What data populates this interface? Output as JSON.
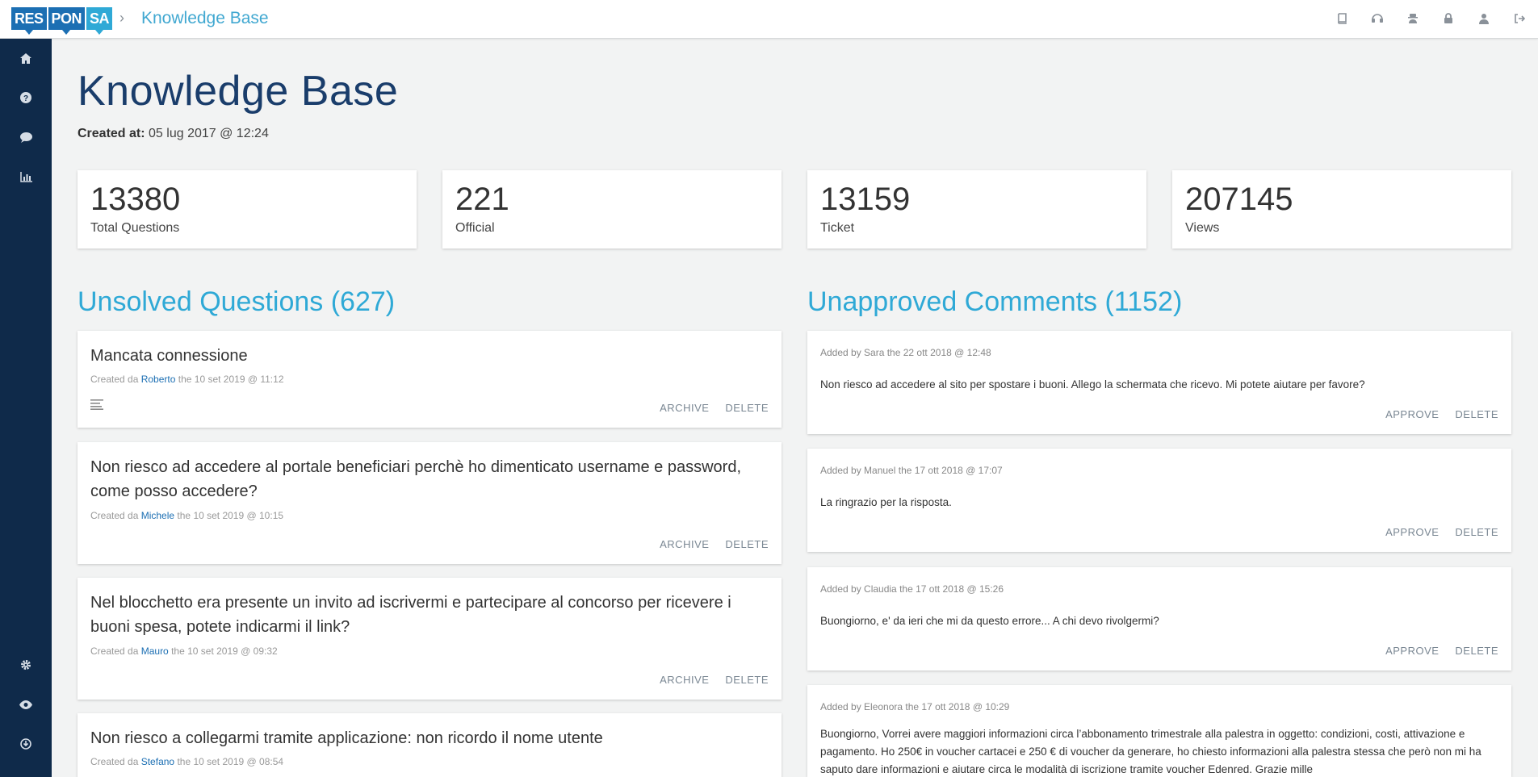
{
  "header": {
    "logo": [
      "RES",
      "PON",
      "SA"
    ],
    "breadcrumb_sep": "›",
    "title": "Knowledge Base",
    "icons": [
      "book-icon",
      "support-icon",
      "user-secret-icon",
      "lock-icon",
      "user-icon",
      "logout-icon"
    ]
  },
  "sidebar": {
    "icons": [
      "home-icon",
      "help-icon",
      "comments-icon",
      "chart-icon",
      "settings-icon",
      "eye-icon",
      "download-icon"
    ]
  },
  "page": {
    "title": "Knowledge Base",
    "created_label": "Created at:",
    "created_value": "05 lug 2017 @ 12:24"
  },
  "stats": [
    {
      "value": "13380",
      "label": "Total Questions"
    },
    {
      "value": "221",
      "label": "Official"
    },
    {
      "value": "13159",
      "label": "Ticket"
    },
    {
      "value": "207145",
      "label": "Views"
    }
  ],
  "unsolved": {
    "title": "Unsolved Questions (627)",
    "archive_label": "ARCHIVE",
    "delete_label": "DELETE",
    "items": [
      {
        "title": "Mancata connessione",
        "created_prefix": "Created da",
        "author": "Roberto",
        "date": "the 10 set 2019 @ 11:12"
      },
      {
        "title": "Non riesco ad accedere al portale beneficiari perchè ho dimenticato username e password, come posso accedere?",
        "created_prefix": "Created da",
        "author": "Michele",
        "date": "the 10 set 2019 @ 10:15"
      },
      {
        "title": "Nel blocchetto era presente un invito ad iscrivermi e partecipare al concorso per ricevere i buoni spesa, potete indicarmi il link?",
        "created_prefix": "Created da",
        "author": "Mauro",
        "date": "the 10 set 2019 @ 09:32"
      },
      {
        "title": "Non riesco a collegarmi tramite applicazione: non ricordo il nome utente",
        "created_prefix": "Created da",
        "author": "Stefano",
        "date": "the 10 set 2019 @ 08:54"
      }
    ]
  },
  "comments": {
    "title": "Unapproved Comments (1152)",
    "approve_label": "APPROVE",
    "delete_label": "DELETE",
    "items": [
      {
        "meta": "Added by Sara the 22 ott 2018 @ 12:48",
        "text": "Non riesco ad accedere al sito per spostare i buoni. Allego la schermata che ricevo. Mi potete aiutare per favore?"
      },
      {
        "meta": "Added by Manuel the 17 ott 2018 @ 17:07",
        "text": "La ringrazio per la risposta."
      },
      {
        "meta": "Added by Claudia the 17 ott 2018 @ 15:26",
        "text": "Buongiorno, e' da ieri che mi da questo errore... A chi devo rivolgermi?"
      },
      {
        "meta": "Added by Eleonora the 17 ott 2018 @ 10:29",
        "text": "Buongiorno, Vorrei avere maggiori informazioni circa l’abbonamento trimestrale alla palestra in oggetto: condizioni, costi, attivazione e pagamento. Ho 250€ in voucher cartacei e 250 € di voucher da generare, ho chiesto informazioni alla palestra stessa che però non mi ha saputo dare informazioni e aiutare circa le modalità di iscrizione tramite voucher Edenred. Grazie mille"
      }
    ]
  }
}
